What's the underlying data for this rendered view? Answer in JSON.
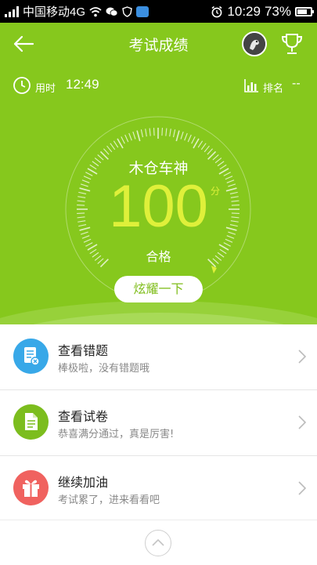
{
  "status_bar": {
    "carrier": "中国移动4G",
    "time": "10:29",
    "battery": "73%",
    "battery_level": 0.73
  },
  "header": {
    "title": "考试成绩",
    "back_icon": "arrow-left-icon",
    "avatar_icon": "user-avatar",
    "trophy_icon": "trophy-icon"
  },
  "stats": {
    "time_label": "用时",
    "time_value": "12:49",
    "rank_label": "排名",
    "rank_value": "--"
  },
  "result": {
    "name": "木仓车神",
    "score": "100",
    "unit": "分",
    "status": "合格",
    "share_button": "炫耀一下"
  },
  "menu": [
    {
      "title": "查看错题",
      "subtitle": "棒极啦，没有错题哦",
      "icon": "document-error-icon",
      "color": "#38a8e8"
    },
    {
      "title": "查看试卷",
      "subtitle": "恭喜满分通过，真是厉害!",
      "icon": "document-icon",
      "color": "#7cbd1e"
    },
    {
      "title": "继续加油",
      "subtitle": "考试累了，进来看看吧",
      "icon": "gift-icon",
      "color": "#f0625f"
    }
  ],
  "colors": {
    "header_green": "#86c81d",
    "score_yellow": "#dff03a"
  }
}
